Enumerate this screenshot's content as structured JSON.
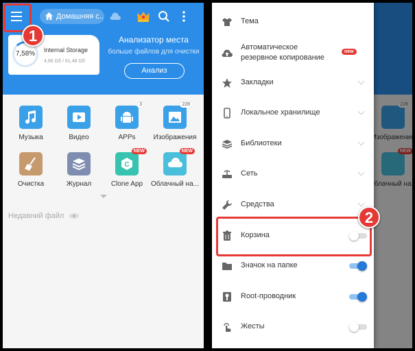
{
  "left": {
    "home_pill": "Домашняя с...",
    "storage": {
      "percent": "7,58%",
      "percent_value": 7.58,
      "title": "Internal Storage",
      "size": "4,66 Gб / 61,48 Gб"
    },
    "analyzer": {
      "title": "Анализатор места",
      "subtitle": "больше файлов для очистки",
      "button": "Анализ"
    },
    "apps": [
      {
        "label": "Музыка",
        "color": "#3aa0e8",
        "icon": "music-icon"
      },
      {
        "label": "Видео",
        "color": "#3aa0e8",
        "icon": "play-icon"
      },
      {
        "label": "APPs",
        "color": "#3aa0e8",
        "icon": "android-icon",
        "badge": "3"
      },
      {
        "label": "Изображения",
        "color": "#3aa0e8",
        "icon": "image-icon",
        "badge": "228"
      },
      {
        "label": "Очистка",
        "color": "#c79a6d",
        "icon": "broom-icon"
      },
      {
        "label": "Журнал",
        "color": "#7f8db0",
        "icon": "layers-icon"
      },
      {
        "label": "Clone App",
        "color": "#36c3b0",
        "icon": "clone-icon",
        "new": "NEW"
      },
      {
        "label": "Облачный на...",
        "color": "#49bfdc",
        "icon": "cloud-icon",
        "new": "NEW"
      }
    ],
    "recent": "Недавний файл",
    "callout": "1"
  },
  "drawer": {
    "items": [
      {
        "label": "Тема",
        "icon": "shirt-icon",
        "control": "none"
      },
      {
        "label": "Автоматическое\nрезервное копирование",
        "line1": "Автоматическое",
        "line2": "резервное копирование",
        "icon": "cloud-upload-icon",
        "control": "new",
        "tag": "new"
      },
      {
        "label": "Закладки",
        "icon": "star-icon",
        "control": "chevron"
      },
      {
        "label": "Локальное хранилище",
        "icon": "phone-icon",
        "control": "chevron"
      },
      {
        "label": "Библиотеки",
        "icon": "library-icon",
        "control": "chevron"
      },
      {
        "label": "Сеть",
        "icon": "network-icon",
        "control": "chevron"
      },
      {
        "label": "Средства",
        "icon": "wrench-icon",
        "control": "chevron"
      },
      {
        "label": "Корзина",
        "icon": "trash-icon",
        "control": "toggle",
        "on": false
      },
      {
        "label": "Значок на папке",
        "icon": "folder-icon",
        "control": "toggle",
        "on": true
      },
      {
        "label": "Root-проводник",
        "icon": "root-icon",
        "control": "toggle",
        "on": true
      },
      {
        "label": "Жесты",
        "icon": "gesture-icon",
        "control": "toggle",
        "on": false
      }
    ],
    "callout": "2"
  },
  "colors": {
    "header_blue": "#2b8de8",
    "accent_red": "#e53935",
    "toggle_on": "#2679d6"
  }
}
